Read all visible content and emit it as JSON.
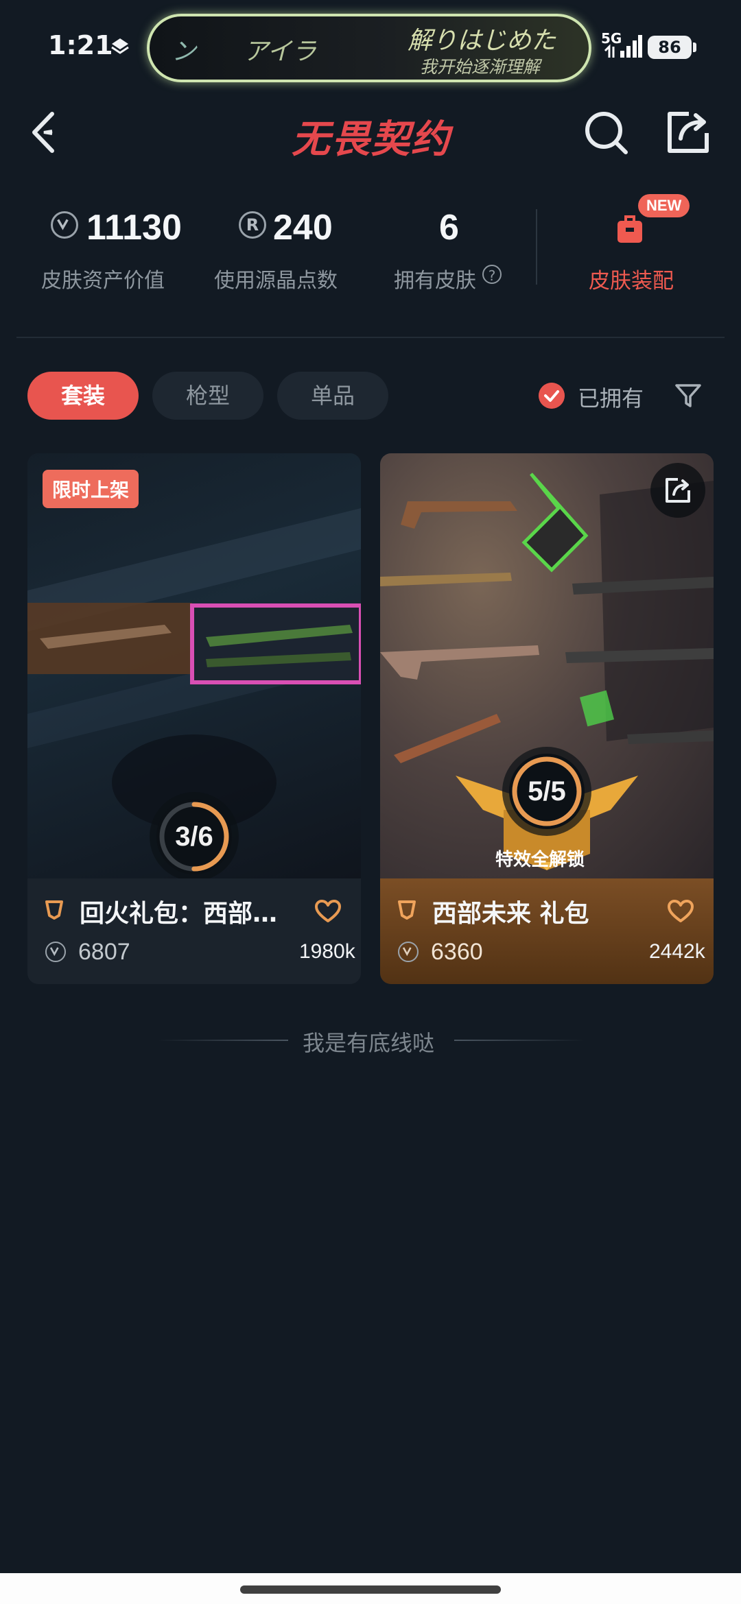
{
  "status_bar": {
    "time": "1:21",
    "lyric_left_1": "ン",
    "lyric_left_2": "アイラ",
    "lyric_right": "解りはじめた",
    "lyric_sub": "我开始逐渐理解",
    "network": "5G",
    "battery": "86"
  },
  "header": {
    "title": "无畏契约"
  },
  "stats": {
    "asset_value": "11130",
    "asset_label": "皮肤资产价值",
    "points": "240",
    "points_label": "使用源晶点数",
    "owned_count": "6",
    "owned_label": "拥有皮肤",
    "help": "?",
    "new_badge": "NEW",
    "loadout_label": "皮肤装配"
  },
  "filters": {
    "tabs": [
      "套装",
      "枪型",
      "单品"
    ],
    "owned_label": "已拥有"
  },
  "cards": [
    {
      "badge": "限时上架",
      "progress": "3/6",
      "progress_fraction": 0.5,
      "title": "回火礼包：西部…",
      "price": "6807",
      "likes": "1980k"
    },
    {
      "progress": "5/5",
      "progress_fraction": 1.0,
      "unlock_label": "特效全解锁",
      "title": "西部未来 礼包",
      "price": "6360",
      "likes": "2442k"
    }
  ],
  "footer": {
    "end_text": "我是有底线哒"
  },
  "colors": {
    "background": "#121a23",
    "accent": "#e8554f",
    "title_red": "#e5484d",
    "gold": "#e89a52"
  }
}
